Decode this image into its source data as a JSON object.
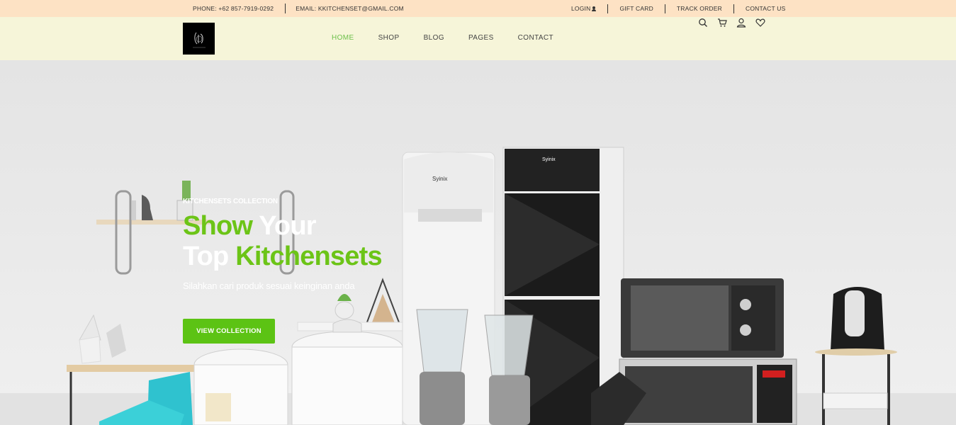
{
  "topbar": {
    "phone": "PHONE: +62 857-7919-0292",
    "email": "EMAIL: KKITCHENSET@GMAIL.COM",
    "links": [
      "LOGIN",
      "GIFT CARD",
      "TRACK ORDER",
      "CONTACT US"
    ]
  },
  "header": {
    "nav": [
      "HOME",
      "SHOP",
      "BLOG",
      "PAGES",
      "CONTACT"
    ],
    "active_nav": "HOME",
    "icons": [
      "search-icon",
      "cart-icon",
      "user-icon",
      "heart-icon"
    ]
  },
  "hero": {
    "kicker": "KITCHENSETS COLLECTION",
    "headline_1_green": "Show",
    "headline_1_white": " Your",
    "headline_2_white": "Top ",
    "headline_2_green": "Kitchensets",
    "subtitle": "Silahkan cari produk sesuai keinginan anda",
    "cta": "VIEW COLLECTION"
  },
  "colors": {
    "accent_green": "#6cc417",
    "topbar_bg": "#fde2c4",
    "header_bg": "#f6f5d9"
  }
}
